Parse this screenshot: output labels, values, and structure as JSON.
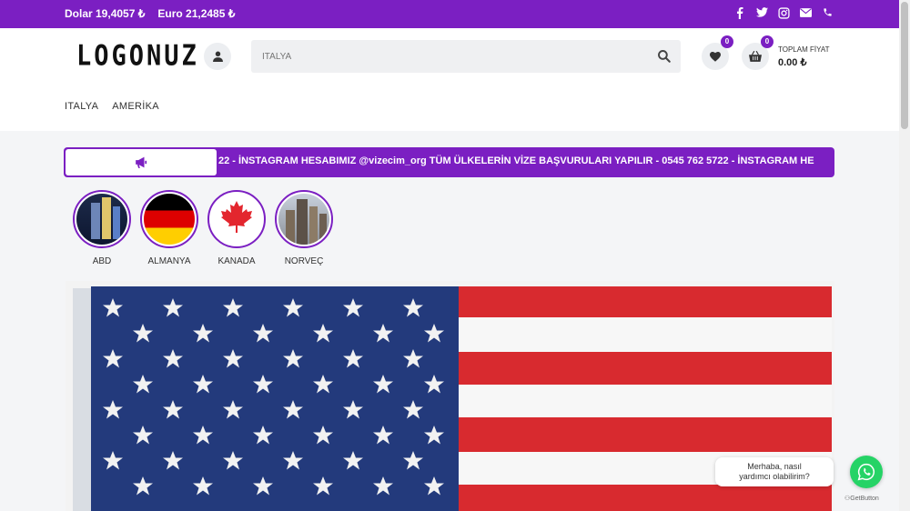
{
  "topbar": {
    "dollar": "Dolar 19,4057 ₺",
    "euro": "Euro 21,2485 ₺",
    "social": [
      "facebook-icon",
      "twitter-icon",
      "instagram-icon",
      "mail-icon",
      "phone-icon"
    ],
    "color": "#7b1fc2"
  },
  "header": {
    "logo": "LOGONUZ",
    "search": {
      "value": "",
      "placeholder": "ITALYA"
    },
    "wishlist_count": "0",
    "cart_count": "0",
    "total_label": "TOPLAM FİYAT",
    "total_value": "0.00 ₺"
  },
  "nav": {
    "items": [
      "ITALYA",
      "AMERİKA"
    ]
  },
  "announcement": {
    "text": "22 - İNSTAGRAM HESABIMIZ @vizecim_org     TÜM ÜLKELERİN VİZE BAŞVURULARI YAPILIR - 0545 762 5722 - İNSTAGRAM HE"
  },
  "stories": [
    {
      "name": "ABD"
    },
    {
      "name": "ALMANYA"
    },
    {
      "name": "KANADA"
    },
    {
      "name": "NORVEÇ"
    }
  ],
  "whatsapp": {
    "bubble_line1": "Merhaba, nasıl",
    "bubble_line2": "yardımcı olabilirim?",
    "brand": "GetButton",
    "color": "#25d366"
  }
}
